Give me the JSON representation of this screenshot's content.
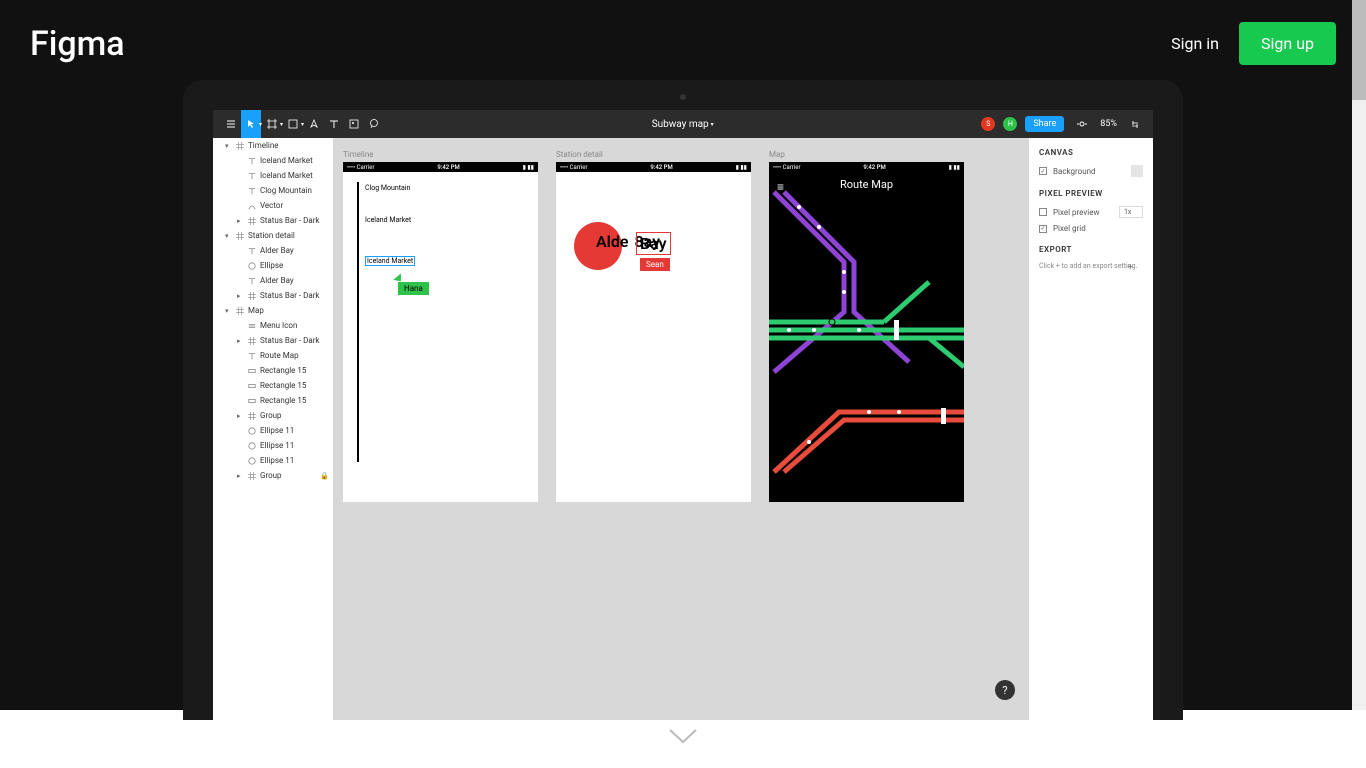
{
  "topbar": {
    "logo": "Figma",
    "signin": "Sign in",
    "signup": "Sign up"
  },
  "toolbar": {
    "doc_title": "Subway map",
    "share": "Share",
    "zoom": "85%"
  },
  "avatars": {
    "s": "S",
    "h": "H"
  },
  "layers": [
    {
      "indent": 1,
      "caret": "▾",
      "icon": "frame",
      "label": "Timeline"
    },
    {
      "indent": 2,
      "icon": "text",
      "label": "Iceland Market"
    },
    {
      "indent": 2,
      "icon": "text",
      "label": "Iceland Market"
    },
    {
      "indent": 2,
      "icon": "text",
      "label": "Clog Mountain"
    },
    {
      "indent": 2,
      "icon": "vector",
      "label": "Vector"
    },
    {
      "indent": 2,
      "caret": "▸",
      "icon": "frame",
      "label": "Status Bar - Dark"
    },
    {
      "indent": 1,
      "caret": "▾",
      "icon": "frame",
      "label": "Station detail"
    },
    {
      "indent": 2,
      "icon": "text",
      "label": "Alder Bay"
    },
    {
      "indent": 2,
      "icon": "ellipse",
      "label": "Ellipse"
    },
    {
      "indent": 2,
      "icon": "text",
      "label": "Alder Bay"
    },
    {
      "indent": 2,
      "caret": "▸",
      "icon": "frame",
      "label": "Status Bar - Dark"
    },
    {
      "indent": 1,
      "caret": "▾",
      "icon": "frame",
      "label": "Map"
    },
    {
      "indent": 2,
      "icon": "menu",
      "label": "Menu Icon"
    },
    {
      "indent": 2,
      "caret": "▸",
      "icon": "frame",
      "label": "Status Bar - Dark"
    },
    {
      "indent": 2,
      "icon": "text",
      "label": "Route Map"
    },
    {
      "indent": 2,
      "icon": "rect",
      "label": "Rectangle 15"
    },
    {
      "indent": 2,
      "icon": "rect",
      "label": "Rectangle 15"
    },
    {
      "indent": 2,
      "icon": "rect",
      "label": "Rectangle 15"
    },
    {
      "indent": 2,
      "caret": "▸",
      "icon": "frame",
      "label": "Group"
    },
    {
      "indent": 2,
      "icon": "ellipse",
      "label": "Ellipse 11"
    },
    {
      "indent": 2,
      "icon": "ellipse",
      "label": "Ellipse 11"
    },
    {
      "indent": 2,
      "icon": "ellipse",
      "label": "Ellipse 11"
    },
    {
      "indent": 2,
      "caret": "▸",
      "icon": "frame",
      "label": "Group",
      "locked": true
    }
  ],
  "artboards": {
    "timeline": {
      "label": "Timeline",
      "carrier": "•••• Carrier",
      "time": "9:42 PM",
      "items": [
        "Clog Mountain",
        "Iceland Market",
        "Iceland Market"
      ],
      "collaborator": "Hana"
    },
    "station": {
      "label": "Station detail",
      "carrier": "•••• Carrier",
      "time": "9:42 PM",
      "text_a": "Alde",
      "text_b": "8ay",
      "text_c": "Bay",
      "collaborator": "Sean"
    },
    "map": {
      "label": "Map",
      "carrier": "•••• Carrier",
      "time": "9:42 PM",
      "title": "Route Map"
    }
  },
  "right_panel": {
    "canvas": "CANVAS",
    "background": "Background",
    "pixel_preview_heading": "PIXEL PREVIEW",
    "pixel_preview": "Pixel preview",
    "pixel_grid": "Pixel grid",
    "preview_scale": "1x",
    "export": "EXPORT",
    "export_hint": "Click + to add an export setting."
  }
}
